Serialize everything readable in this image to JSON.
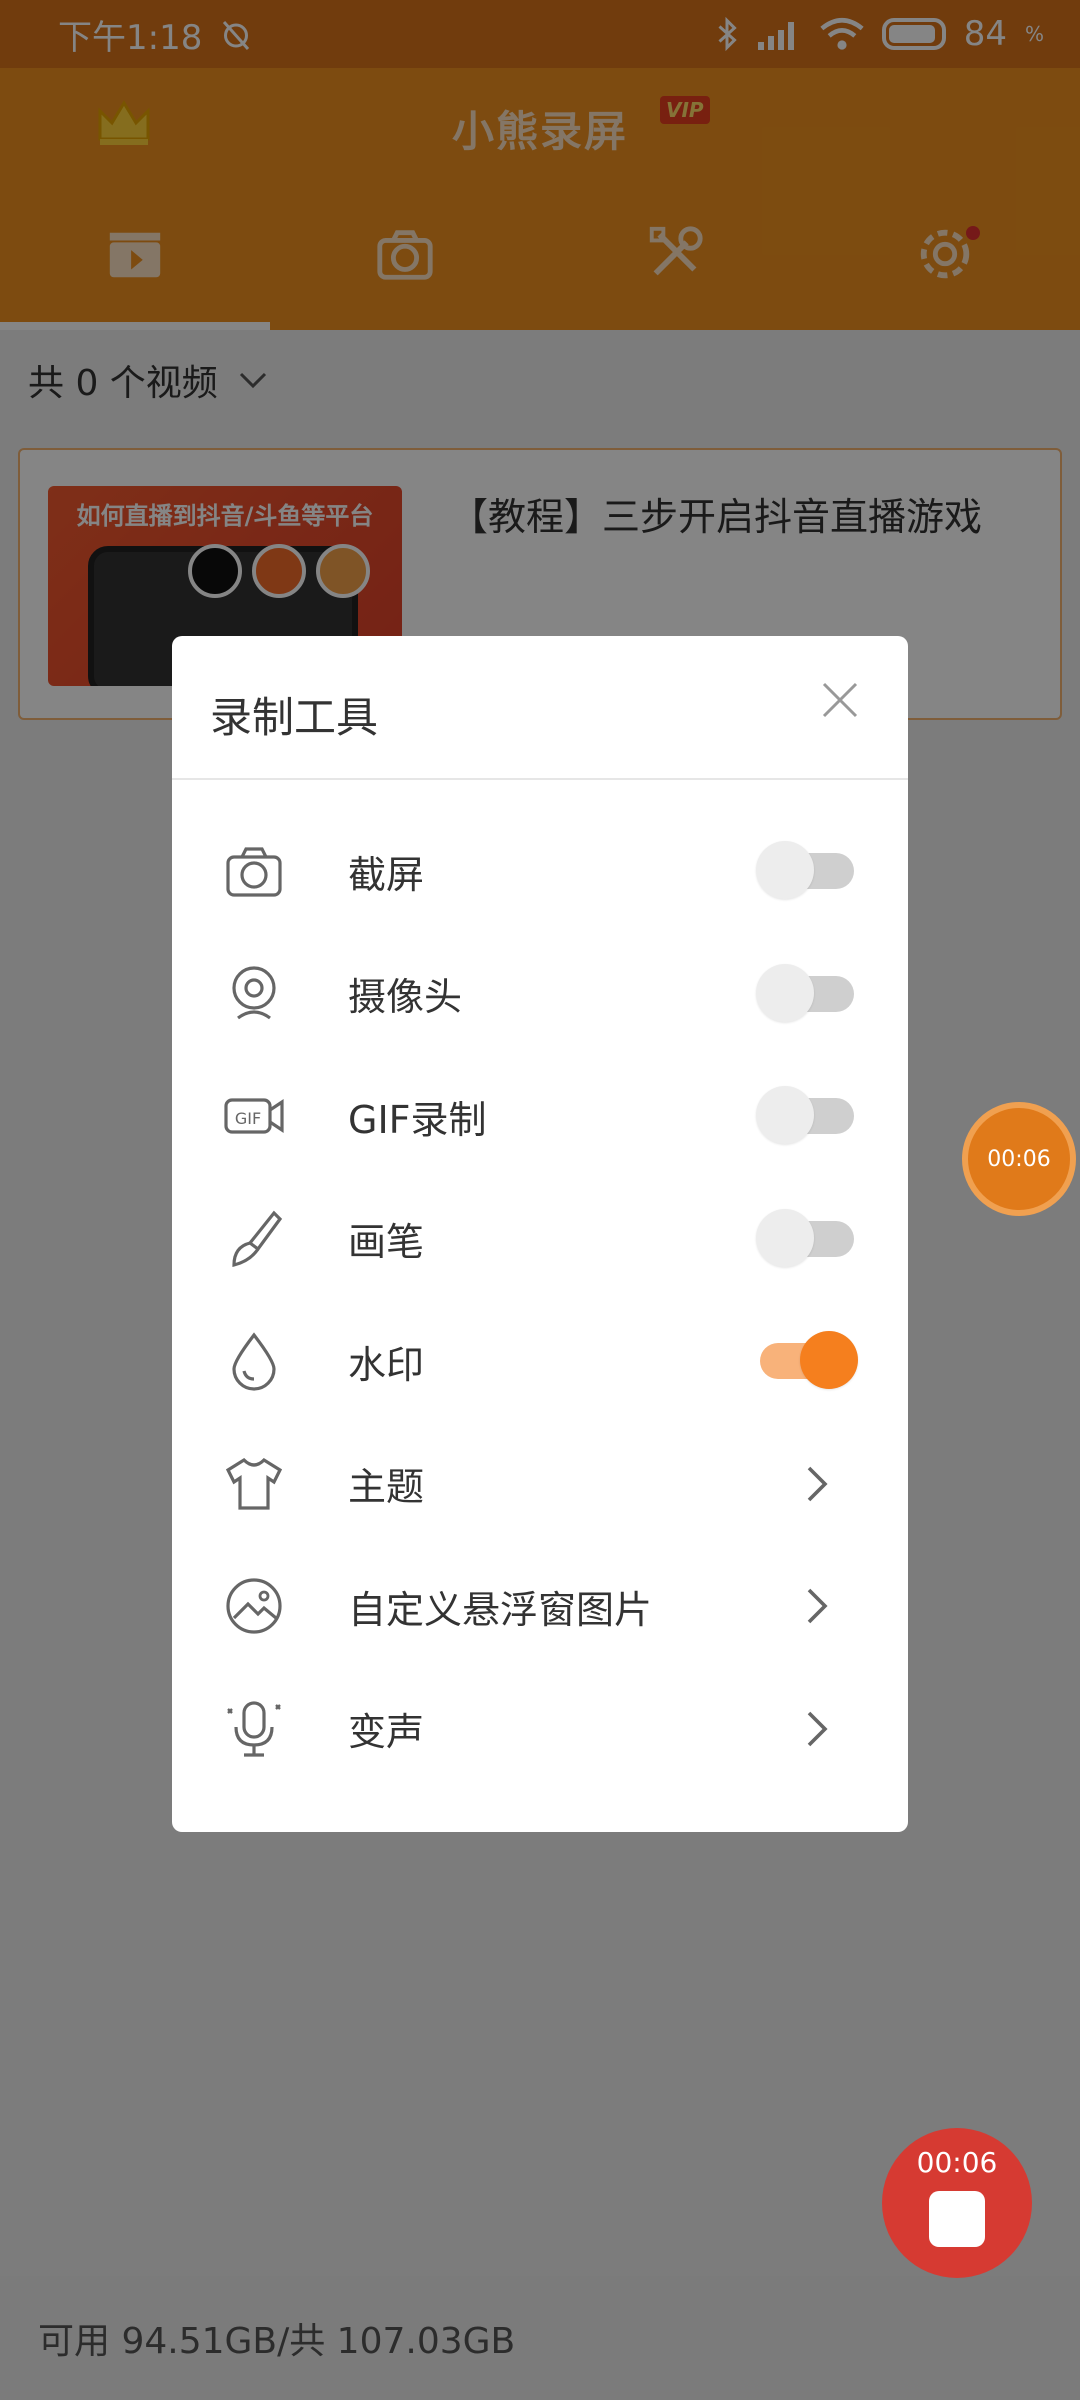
{
  "status_bar": {
    "time": "下午1:18",
    "battery": "84"
  },
  "app": {
    "title": "小熊录屏",
    "vip_badge": "VIP"
  },
  "tabs": [
    {
      "name": "videos",
      "icon": "video-clapper-icon",
      "active": true
    },
    {
      "name": "screenshots",
      "icon": "camera-icon",
      "active": false
    },
    {
      "name": "tools",
      "icon": "tools-icon",
      "active": false
    },
    {
      "name": "settings",
      "icon": "gear-icon",
      "active": false,
      "badge": true
    }
  ],
  "video_list": {
    "count_label": "共 0 个视频",
    "card": {
      "thumb_caption": "如何直播到抖音/斗鱼等平台",
      "title": "【教程】三步开启抖音直播游戏"
    }
  },
  "dialog": {
    "title": "录制工具",
    "items": [
      {
        "label": "截屏",
        "icon": "camera-icon",
        "type": "toggle",
        "on": false
      },
      {
        "label": "摄像头",
        "icon": "webcam-icon",
        "type": "toggle",
        "on": false
      },
      {
        "label": "GIF录制",
        "icon": "gif-icon",
        "type": "toggle",
        "on": false
      },
      {
        "label": "画笔",
        "icon": "brush-icon",
        "type": "toggle",
        "on": false
      },
      {
        "label": "水印",
        "icon": "water-drop-icon",
        "type": "toggle",
        "on": true
      },
      {
        "label": "主题",
        "icon": "tshirt-icon",
        "type": "link"
      },
      {
        "label": "自定义悬浮窗图片",
        "icon": "image-icon",
        "type": "link"
      },
      {
        "label": "变声",
        "icon": "microphone-icon",
        "type": "link"
      }
    ]
  },
  "floating_timer": "00:06",
  "record_button": {
    "time": "00:06"
  },
  "storage": {
    "text": "可用 94.51GB/共 107.03GB"
  },
  "colors": {
    "accent": "#f0911f",
    "toggle_on": "#f57f1e",
    "stop_red": "#d63a32"
  }
}
